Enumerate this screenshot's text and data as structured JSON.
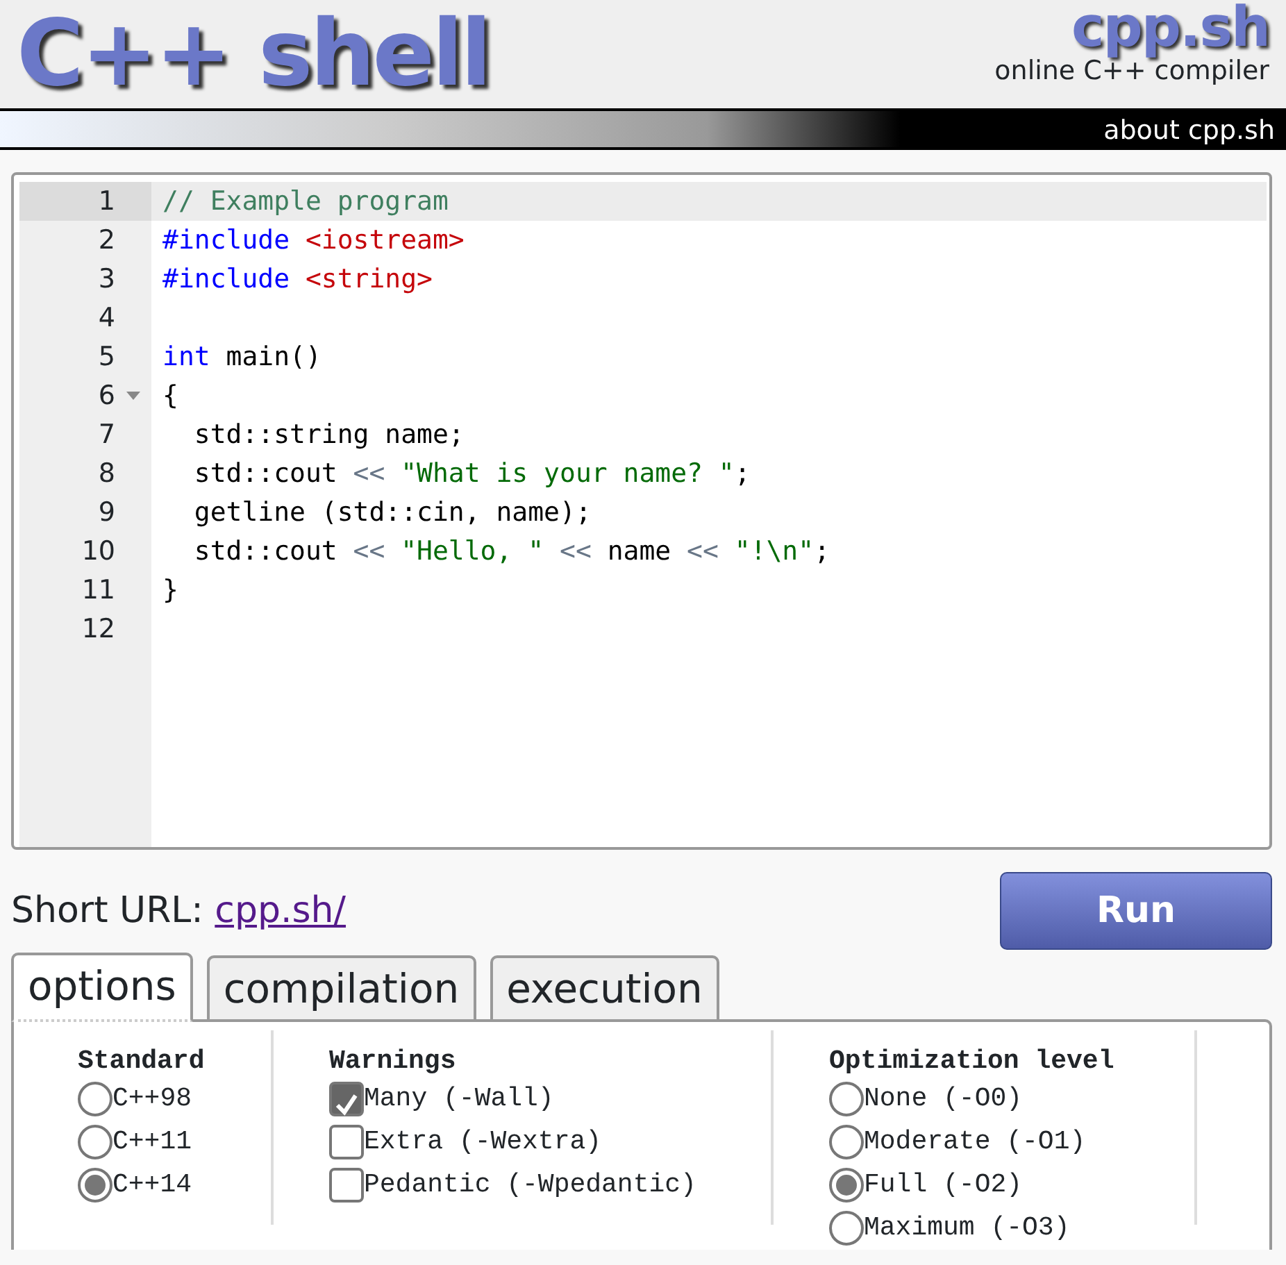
{
  "header": {
    "logo": "C++ shell",
    "brand": "cpp.sh",
    "tagline": "online C++ compiler",
    "about_link": "about cpp.sh"
  },
  "editor": {
    "lines": [
      {
        "number": "1",
        "active": true,
        "foldable": false,
        "tokens": [
          {
            "kind": "comment",
            "text": "// Example program"
          }
        ]
      },
      {
        "number": "2",
        "active": false,
        "foldable": false,
        "tokens": [
          {
            "kind": "keyword",
            "text": "#include"
          },
          {
            "kind": "header",
            "text": " <iostream>"
          }
        ]
      },
      {
        "number": "3",
        "active": false,
        "foldable": false,
        "tokens": [
          {
            "kind": "keyword",
            "text": "#include"
          },
          {
            "kind": "header",
            "text": " <string>"
          }
        ]
      },
      {
        "number": "4",
        "active": false,
        "foldable": false
      },
      {
        "number": "5",
        "active": false,
        "foldable": false,
        "tokens": [
          {
            "kind": "keyword",
            "text": "int"
          },
          {
            "kind": "plain",
            "text": " main()"
          }
        ]
      },
      {
        "number": "6",
        "active": false,
        "foldable": true,
        "tokens": [
          {
            "kind": "plain",
            "text": "{"
          }
        ]
      },
      {
        "number": "7",
        "active": false,
        "foldable": false,
        "tokens": [
          {
            "kind": "plain",
            "text": "  std::string name;"
          }
        ]
      },
      {
        "number": "8",
        "active": false,
        "foldable": false,
        "tokens": [
          {
            "kind": "plain",
            "text": "  std::cout"
          },
          {
            "kind": "operator",
            "text": " << "
          },
          {
            "kind": "string",
            "text": "\"What is your name? \""
          },
          {
            "kind": "plain",
            "text": ";"
          }
        ]
      },
      {
        "number": "9",
        "active": false,
        "foldable": false,
        "tokens": [
          {
            "kind": "plain",
            "text": "  getline (std::cin, name);"
          }
        ]
      },
      {
        "number": "10",
        "active": false,
        "foldable": false,
        "tokens": [
          {
            "kind": "plain",
            "text": "  std::cout"
          },
          {
            "kind": "operator",
            "text": " << "
          },
          {
            "kind": "string",
            "text": "\"Hello, \""
          },
          {
            "kind": "operator",
            "text": " << "
          },
          {
            "kind": "plain",
            "text": "name"
          },
          {
            "kind": "operator",
            "text": " << "
          },
          {
            "kind": "string",
            "text": "\"!\\n\""
          },
          {
            "kind": "plain",
            "text": ";"
          }
        ]
      },
      {
        "number": "11",
        "active": false,
        "foldable": false,
        "tokens": [
          {
            "kind": "plain",
            "text": "}"
          }
        ]
      },
      {
        "number": "12",
        "active": false,
        "foldable": false
      }
    ]
  },
  "short_url": {
    "label": "Short URL:",
    "link": "cpp.sh/"
  },
  "run_button": "Run",
  "tabs": [
    {
      "label": "options",
      "selected": true
    },
    {
      "label": "compilation",
      "selected": false
    },
    {
      "label": "execution",
      "selected": false
    }
  ],
  "option_groups": [
    {
      "title": "Standard",
      "kind": "radio",
      "items": [
        {
          "label": "C++98",
          "selected": false
        },
        {
          "label": "C++11",
          "selected": false
        },
        {
          "label": "C++14",
          "selected": true
        }
      ]
    },
    {
      "title": "Warnings",
      "kind": "checkbox",
      "items": [
        {
          "label": "Many (-Wall)",
          "checked": true
        },
        {
          "label": "Extra (-Wextra)",
          "checked": false
        },
        {
          "label": "Pedantic (-Wpedantic)",
          "checked": false
        }
      ]
    },
    {
      "title": "Optimization level",
      "kind": "radio",
      "items": [
        {
          "label": "None (-O0)",
          "selected": false
        },
        {
          "label": "Moderate (-O1)",
          "selected": false
        },
        {
          "label": "Full (-O2)",
          "selected": true
        },
        {
          "label": "Maximum (-O3)",
          "selected": false
        }
      ]
    }
  ]
}
